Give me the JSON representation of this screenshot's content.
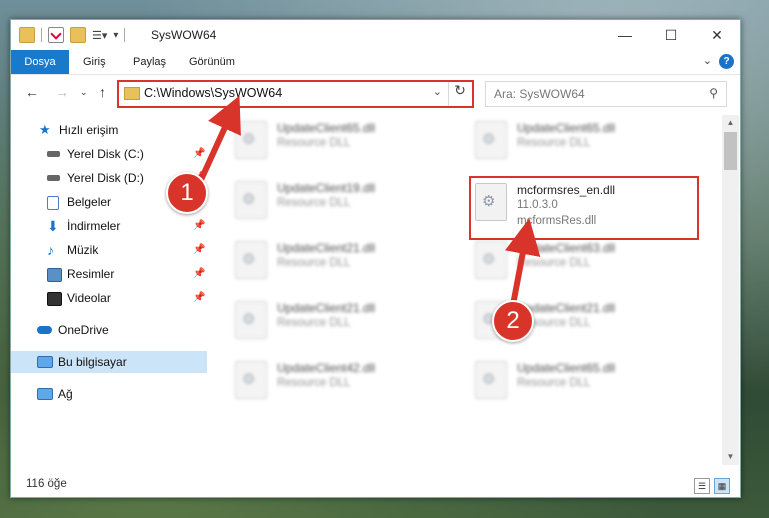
{
  "window": {
    "title": "SysWOW64",
    "controls": {
      "minimize": "—",
      "maximize": "☐",
      "close": "✕"
    }
  },
  "ribbon": {
    "tabs": [
      "Dosya",
      "Giriş",
      "Paylaş",
      "Görünüm"
    ],
    "help": "?"
  },
  "navigation": {
    "address": "C:\\Windows\\SysWOW64",
    "search_placeholder": "Ara: SysWOW64"
  },
  "sidebar": {
    "items": [
      {
        "label": "Hızlı erişim",
        "icon": "star-icon",
        "pinned": false
      },
      {
        "label": "Yerel Disk (C:)",
        "icon": "drive-icon",
        "pinned": true
      },
      {
        "label": "Yerel Disk (D:)",
        "icon": "drive-icon",
        "pinned": true
      },
      {
        "label": "Belgeler",
        "icon": "documents-icon",
        "pinned": true
      },
      {
        "label": "İndirmeler",
        "icon": "download-icon",
        "pinned": true
      },
      {
        "label": "Müzik",
        "icon": "music-icon",
        "pinned": true
      },
      {
        "label": "Resimler",
        "icon": "pictures-icon",
        "pinned": true
      },
      {
        "label": "Videolar",
        "icon": "videos-icon",
        "pinned": true
      },
      {
        "label": "OneDrive",
        "icon": "cloud-icon",
        "pinned": false
      },
      {
        "label": "Bu bilgisayar",
        "icon": "computer-icon",
        "pinned": false,
        "selected": true
      },
      {
        "label": "Ağ",
        "icon": "network-icon",
        "pinned": false
      }
    ]
  },
  "files": {
    "left_column": [
      {
        "name": "UpdateClient65.dll",
        "type": "Resource DLL"
      },
      {
        "name": "UpdateClient19.dll",
        "type": "Resource DLL"
      },
      {
        "name": "UpdateClient21.dll",
        "type": "Resource DLL"
      },
      {
        "name": "UpdateClient21.dll",
        "type": "Resource DLL"
      },
      {
        "name": "UpdateClient42.dll",
        "type": "Resource DLL"
      }
    ],
    "right_column": [
      {
        "name": "UpdateClient65.dll",
        "type": "Resource DLL"
      },
      {
        "name": "UpdateClient63.dll",
        "type": "Resource DLL"
      },
      {
        "name": "UpdateClient21.dll",
        "type": "Resource DLL"
      },
      {
        "name": "UpdateClient65.dll",
        "type": "Resource DLL"
      }
    ],
    "highlighted": {
      "name": "mcformsres_en.dll",
      "version": "11.0.3.0",
      "description": "mcformsRes.dll"
    }
  },
  "status": {
    "item_count": "116 öğe"
  },
  "annotations": {
    "step1": "1",
    "step2": "2",
    "color": "#d8342a"
  }
}
